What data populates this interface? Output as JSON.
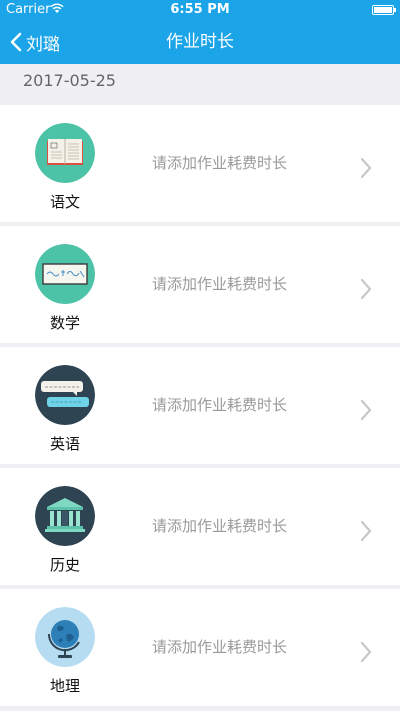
{
  "status_bar": {
    "carrier": "Carrier",
    "time": "6:55 PM",
    "battery_level": 1.0
  },
  "nav": {
    "back_label": "刘璐",
    "title": "作业时长",
    "color": "#1ba4e8"
  },
  "date": "2017-05-25",
  "subjects": [
    {
      "name": "语文",
      "hint": "请添加作业耗费时长",
      "icon": "book-icon",
      "icon_bg": "#4cc2a6"
    },
    {
      "name": "数学",
      "hint": "请添加作业耗费时长",
      "icon": "chalkboard-icon",
      "icon_bg": "#4cc2a6"
    },
    {
      "name": "英语",
      "hint": "请添加作业耗费时长",
      "icon": "speech-bubbles-icon",
      "icon_bg": "#2e4453"
    },
    {
      "name": "历史",
      "hint": "请添加作业耗费时长",
      "icon": "temple-icon",
      "icon_bg": "#2e4453"
    },
    {
      "name": "地理",
      "hint": "请添加作业耗费时长",
      "icon": "globe-icon",
      "icon_bg": "#b6dcf1"
    }
  ]
}
